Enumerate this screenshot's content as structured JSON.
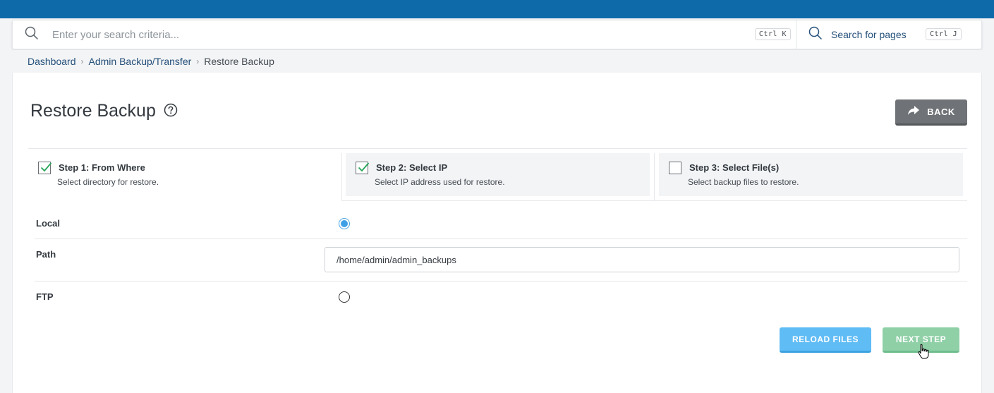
{
  "search": {
    "placeholder": "Enter your search criteria...",
    "shortcut": "Ctrl K",
    "pages_label": "Search for pages",
    "pages_shortcut": "Ctrl J"
  },
  "breadcrumb": {
    "items": [
      "Dashboard",
      "Admin Backup/Transfer"
    ],
    "current": "Restore Backup"
  },
  "page": {
    "title": "Restore Backup",
    "back_label": "BACK"
  },
  "steps": [
    {
      "title": "Step 1: From Where",
      "description": "Select directory for restore.",
      "checked": true
    },
    {
      "title": "Step 2: Select IP",
      "description": "Select IP address used for restore.",
      "checked": true
    },
    {
      "title": "Step 3: Select File(s)",
      "description": "Select backup files to restore.",
      "checked": false
    }
  ],
  "form": {
    "local_label": "Local",
    "local_selected": true,
    "path_label": "Path",
    "path_value": "/home/admin/admin_backups",
    "ftp_label": "FTP",
    "ftp_selected": false
  },
  "actions": {
    "reload_label": "RELOAD FILES",
    "next_label": "NEXT STEP"
  },
  "colors": {
    "topbar": "#0e6aa8",
    "link": "#24507a",
    "reload_button": "#5fbcf5",
    "next_button": "#8fd0a7",
    "back_button": "#6f7276",
    "checkmark": "#27a55a"
  }
}
